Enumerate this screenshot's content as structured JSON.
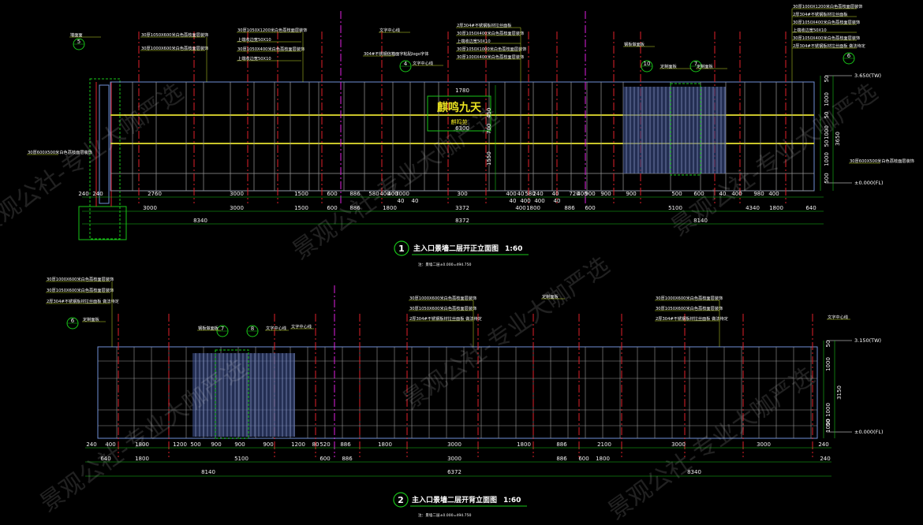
{
  "colors": {
    "background": "#000000",
    "wall_outline": "#6f8fd6",
    "dimension": "#18c418",
    "leader": "#c8e02a",
    "axis_red": "#e0202a",
    "axis_magenta": "#e020e0",
    "yellow_band": "#c9c42a",
    "grid_line": "#c8c8c8",
    "sign_text": "#e8e020"
  },
  "elevation1": {
    "title": "主入口景墙二层开正立面图",
    "scale": "1:60",
    "number": "1",
    "subtitle": "注：景墙二层±0.000=494.750",
    "dims_row1": [
      "240",
      "240",
      "2760",
      "3000",
      "1500",
      "600",
      "886",
      "580",
      "400",
      "400",
      "3000",
      "300",
      "400",
      "40",
      "580",
      "240",
      "40",
      "720",
      "400",
      "900",
      "900",
      "900",
      "500",
      "600",
      "40",
      "400",
      "980",
      "400"
    ],
    "dims_row2": [
      "3000",
      "3000",
      "1500",
      "600",
      "886",
      "1800",
      "3372",
      "400",
      "1800",
      "886",
      "600",
      "5100",
      "4340",
      "1800",
      "640"
    ],
    "dims_row3": [
      "8340",
      "8372",
      "8140"
    ],
    "small_dims": [
      "40",
      "40",
      "40",
      "400",
      "400",
      "40"
    ],
    "vertical_dims": [
      "50",
      "1000",
      "50",
      "1000",
      "50",
      "1000",
      "500",
      "3650"
    ],
    "level_top": "3.650(TW)",
    "level_base": "±0.000(FL)",
    "sign_text": "麒鸣九天",
    "sign_sub": "麒鸣苑",
    "sign_dim_top": "1780",
    "sign_dim_bottom": "6300",
    "sign_height_dims": [
      "450",
      "700",
      "1550"
    ],
    "detail_bubbles": [
      "5",
      "4",
      "10",
      "7",
      "6"
    ],
    "notes_left": [
      "30厚1050X600米白色荔枝面层装饰",
      "30厚1000X600米白色荔枝面层装饰"
    ],
    "notes_center": [
      "30厚1050X1200米白色荔枝面层装饰",
      "上端收边宽50X10",
      "30厚1050X400米白色荔枝面层装饰",
      "上端收边宽50X10"
    ],
    "notes_right1": [
      "2厚304#不锈钢板材拉丝面板",
      "30厚1050X400米白色荔枝面层装饰",
      "上端收边宽50X10",
      "30厚1050X1000米白色荔枝面层装饰",
      "30厚1000X400米白色荔枝面层装饰"
    ],
    "notes_right2": [
      "30厚1000X1200米白色荔枝面层装饰",
      "2厚304#不锈钢板材拉丝面板",
      "30厚1050X400米白色荔枝面层装饰",
      "上端收边宽50X10",
      "30厚1050X400米白色荔枝面层装饰",
      "2厚304#不锈钢板材拉丝面板 做法待定"
    ],
    "other_notes": [
      "墙面面",
      "文字中心线",
      "304#不锈钢信箱面字粘贴logo字体",
      "文字中心线",
      "钢板做面板",
      "定制面板",
      "定制面板",
      "30厚600X500米白色荔枝面层装饰",
      "30厚600X500米白色荔枝面层装饰"
    ]
  },
  "elevation2": {
    "title": "主入口景墙二层开背立面图",
    "scale": "1:60",
    "number": "2",
    "subtitle": "注：景墙二层±0.000=494.750",
    "dims_row1": [
      "240",
      "400",
      "1800",
      "1200",
      "500",
      "900",
      "900",
      "900",
      "1200",
      "80",
      "520",
      "886",
      "1800",
      "3000",
      "1800",
      "886",
      "2100",
      "3000",
      "3000",
      "240"
    ],
    "dims_row2": [
      "640",
      "1800",
      "5100",
      "600",
      "886",
      "3000",
      "886",
      "600",
      "1800",
      "240"
    ],
    "dims_row3": [
      "8140",
      "6372",
      "8340"
    ],
    "vertical_dims": [
      "50",
      "1000",
      "3150",
      "1000",
      "50",
      "1000"
    ],
    "level_top": "3.150(TW)",
    "level_base": "±0.000(FL)",
    "detail_bubbles": [
      "6",
      "7",
      "8"
    ],
    "notes_left": [
      "30厚1000X600米白色荔枝面层装饰",
      "30厚1050X600米白色荔枝面层装饰",
      "2厚304#不锈钢板材拉丝面板 做法待定"
    ],
    "notes_center": [
      "30厚1000X600米白色荔枝面层装饰",
      "30厚1050X600米白色荔枝面层装饰",
      "2厚304#不锈钢板材拉丝面板 做法待定"
    ],
    "notes_right": [
      "30厚1000X600米白色荔枝面层装饰",
      "30厚1050X600米白色荔枝面层装饰",
      "2厚304#不锈钢板材拉丝面板 做法待定"
    ],
    "other_notes": [
      "定制面板",
      "钢板做面板",
      "文字中心线",
      "文字中心线",
      "定制面板",
      "文字中心线"
    ]
  },
  "watermark": "景观公社-专业大咖严选"
}
